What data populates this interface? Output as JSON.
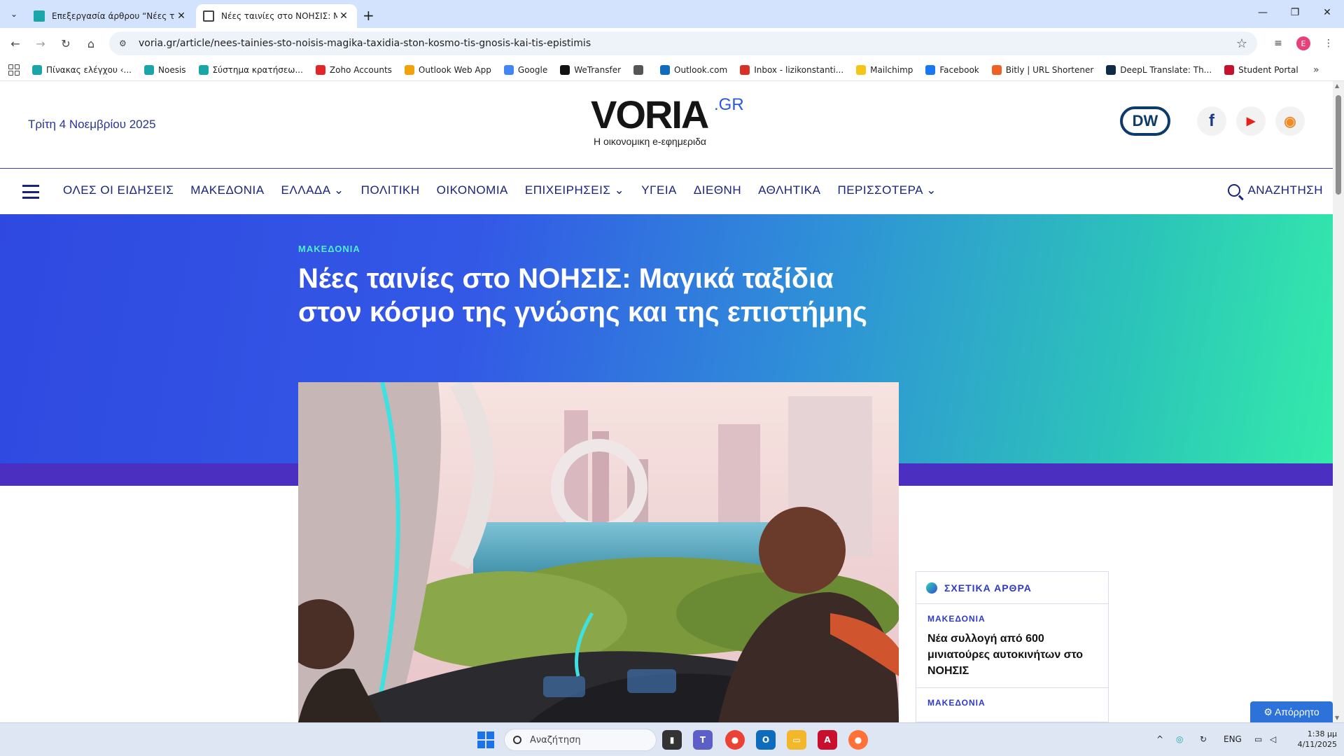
{
  "browser": {
    "tabs": [
      {
        "title": "Επεξεργασία άρθρου “Νέες ται",
        "active": false
      },
      {
        "title": "Νέες ταινίες στο ΝΟΗΣΙΣ: Μαγ",
        "active": true
      }
    ],
    "url": "voria.gr/article/nees-tainies-sto-noisis-magika-taxidia-ston-kosmo-tis-gnosis-kai-tis-epistimis",
    "profile_initial": "E",
    "bookmarks": [
      {
        "label": "Πίνακας ελέγχου ‹...",
        "color": "#1aa5a8"
      },
      {
        "label": "Noesis",
        "color": "#1aa5a8"
      },
      {
        "label": "Σύστημα κρατήσεω...",
        "color": "#1aa5a8"
      },
      {
        "label": "Zoho Accounts",
        "color": "#e42527"
      },
      {
        "label": "Outlook Web App",
        "color": "#f0a30a"
      },
      {
        "label": "Google",
        "color": "#4285f4"
      },
      {
        "label": "WeTransfer",
        "color": "#111111"
      },
      {
        "label": "",
        "color": "#555555"
      },
      {
        "label": "Outlook.com",
        "color": "#0f6cbd"
      },
      {
        "label": "Inbox - lizikonstanti...",
        "color": "#d93025"
      },
      {
        "label": "Mailchimp",
        "color": "#f5c518"
      },
      {
        "label": "Facebook",
        "color": "#1877f2"
      },
      {
        "label": "Bitly | URL Shortener",
        "color": "#ee6123"
      },
      {
        "label": "DeepL Translate: Th...",
        "color": "#0f2b46"
      },
      {
        "label": "Student Portal",
        "color": "#c8102e"
      }
    ]
  },
  "site": {
    "date": "Τρίτη 4 Νοεμβρίου 2025",
    "logo_word": "VORIA",
    "logo_suffix": ".GR",
    "tagline": "Η οικονομικη e-εφημεριδα",
    "dw_label": "DW",
    "social": [
      {
        "name": "facebook",
        "glyph": "f",
        "color": "#1a3b8a"
      },
      {
        "name": "youtube",
        "glyph": "▶",
        "color": "#e62117"
      },
      {
        "name": "rss",
        "glyph": "◉",
        "color": "#f08a24"
      }
    ],
    "nav": [
      "ΟΛΕΣ ΟΙ ΕΙΔΗΣΕΙΣ",
      "ΜΑΚΕΔΟΝΙΑ",
      "ΕΛΛΑΔΑ ⌄",
      "ΠΟΛΙΤΙΚΗ",
      "ΟΙΚΟΝΟΜΙΑ",
      "ΕΠΙΧΕΙΡΗΣΕΙΣ ⌄",
      "ΥΓΕΙΑ",
      "ΔΙΕΘΝΗ",
      "ΑΘΛΗΤΙΚΑ",
      "ΠΕΡΙΣΣΟΤΕΡΑ ⌄"
    ],
    "search_label": "ΑΝΑΖΗΤΗΣΗ"
  },
  "article": {
    "category": "ΜΑΚΕΔΟΝΙΑ",
    "title": "Νέες ταινίες στο ΝΟΗΣΙΣ: Μαγικά ταξίδια στον κόσμο της γνώσης και της επιστήμης"
  },
  "related": {
    "heading": "ΣΧΕΤΙΚΑ ΑΡΘΡΑ",
    "items": [
      {
        "category": "ΜΑΚΕΔΟΝΙΑ",
        "title": "Νέα συλλογή από 600 μινιατούρες αυτοκινήτων στο ΝΟΗΣΙΣ"
      },
      {
        "category": "ΜΑΚΕΔΟΝΙΑ",
        "title": ""
      }
    ]
  },
  "consent_label": "⚙ Απόρρητο",
  "taskbar": {
    "search_placeholder": "Αναζήτηση",
    "lang": "ENG",
    "time": "1:38 μμ",
    "date": "4/11/2025"
  }
}
